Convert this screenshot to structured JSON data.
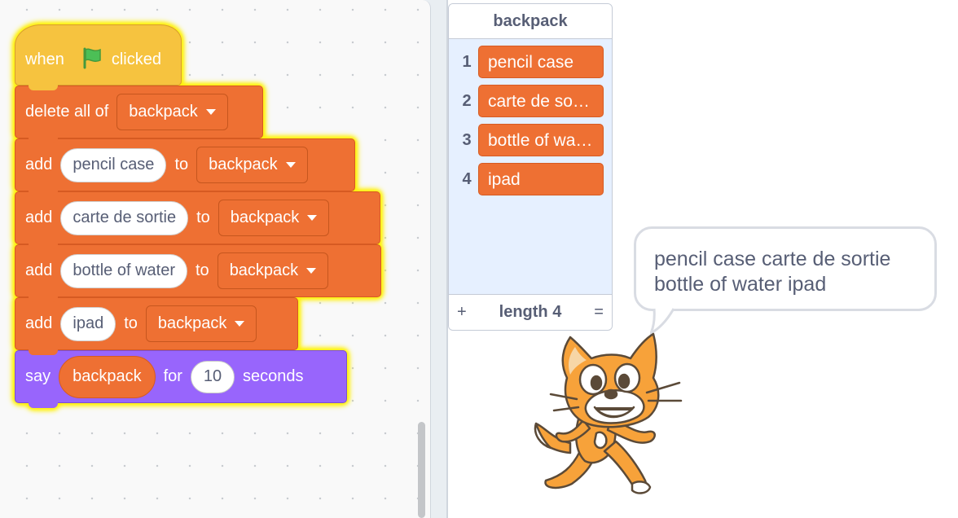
{
  "script": {
    "hat": {
      "when": "when",
      "flag_icon": "green-flag-icon",
      "clicked": "clicked"
    },
    "delete_block": {
      "label": "delete all of",
      "list": "backpack"
    },
    "add_blocks": [
      {
        "add": "add",
        "item": "pencil case",
        "to": "to",
        "list": "backpack"
      },
      {
        "add": "add",
        "item": "carte de sortie",
        "to": "to",
        "list": "backpack"
      },
      {
        "add": "add",
        "item": "bottle of water",
        "to": "to",
        "list": "backpack"
      },
      {
        "add": "add",
        "item": "ipad",
        "to": "to",
        "list": "backpack"
      }
    ],
    "say_block": {
      "say": "say",
      "message": "backpack",
      "for": "for",
      "seconds_value": "10",
      "seconds": "seconds"
    }
  },
  "list_monitor": {
    "title": "backpack",
    "items": [
      {
        "index": "1",
        "value": "pencil case"
      },
      {
        "index": "2",
        "value": "carte de sortie"
      },
      {
        "index": "3",
        "value": "bottle of water"
      },
      {
        "index": "4",
        "value": "ipad"
      }
    ],
    "add_symbol": "+",
    "length_label": "length 4",
    "resize_symbol": "="
  },
  "speech_bubble": {
    "text": "pencil case carte de sortie bottle of water ipad"
  },
  "colors": {
    "events": "#f6c33f",
    "lists": "#ee7033",
    "looks": "#9865fc",
    "glow": "#fff10a"
  }
}
